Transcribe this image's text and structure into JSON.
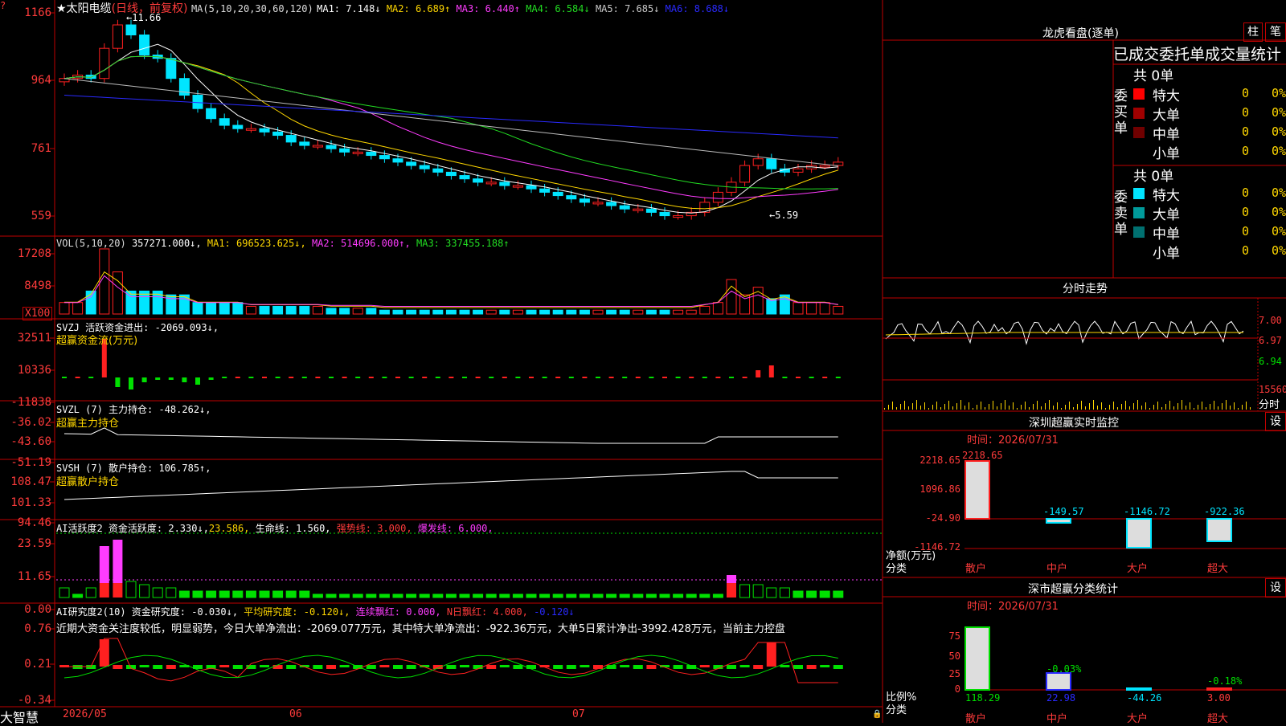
{
  "stock": {
    "title": "★太阳电缆",
    "period": "(日线，前复权)",
    "ma_label": "MA(5,10,20,30,60,120)",
    "ma": [
      {
        "label": "MA1: 7.148",
        "arrow": "↓",
        "color": "#ffffff"
      },
      {
        "label": "MA2: 6.689",
        "arrow": "↑",
        "color": "#ffd700"
      },
      {
        "label": "MA3: 6.440",
        "arrow": "↑",
        "color": "#ff3cff"
      },
      {
        "label": "MA4: 6.584",
        "arrow": "↓",
        "color": "#22dd22"
      },
      {
        "label": "MA5: 7.685",
        "arrow": "↓",
        "color": "#cccccc"
      },
      {
        "label": "MA6: 8.688",
        "arrow": "↓",
        "color": "#2a2aff"
      }
    ],
    "high_label": "11.66",
    "low_label": "5.59",
    "y_ticks": [
      "1166",
      "964",
      "761",
      "559"
    ]
  },
  "vol": {
    "label": "VOL(5,10,20)",
    "val": "357271.000↓,",
    "ma1": "MA1: 696523.625↓,",
    "ma2": "MA2: 514696.000↑,",
    "ma3": "MA3: 337455.188↑",
    "y_ticks": [
      "17208",
      "8498"
    ],
    "unit": "X100"
  },
  "svzj": {
    "label": "SVZJ  活跃资金进出: -2069.093↓,",
    "sub": "超赢资金流(万元)",
    "y_ticks": [
      "32511",
      "10336",
      "-11838"
    ]
  },
  "svzl": {
    "label": "SVZL (7) 主力持仓: -48.262↓,",
    "sub": "超赢主力持仓",
    "y_ticks": [
      "-36.02",
      "-43.60",
      "-51.19"
    ]
  },
  "svsh": {
    "label": "SVSH (7) 散户持仓: 106.785↑,",
    "sub": "超赢散户持仓",
    "y_ticks": [
      "108.47",
      "101.33",
      "94.46"
    ]
  },
  "ai1": {
    "label": "AI活跃度2 资金活跃度: 2.330↓,",
    "v2": "23.586,",
    "v3": "生命线: 1.560,",
    "v4": "强势线: 3.000,",
    "v5": "爆发线: 6.000,",
    "y_ticks": [
      "23.59",
      "11.65",
      "0.00"
    ]
  },
  "ai2": {
    "label": "AI研究度2(10) 资金研究度: -0.030↓,",
    "v2": "平均研究度: -0.120↓,",
    "v3": "连续飘红: 0.000,",
    "v4": "N日飘红: 4.000,",
    "v5": "-0.120↓",
    "text": "近期大资金关注度较低，明显弱势，今日大单净流出：-2069.077万元，其中特大单净流出：-922.36万元，大单5日累计净出-3992.428万元，当前主力控盘",
    "y_ticks": [
      "0.76",
      "0.21",
      "-0.34"
    ]
  },
  "xaxis": {
    "labels": [
      "2026/05",
      "06",
      "07"
    ],
    "brand": "大智慧"
  },
  "right": {
    "lh_title": "龙虎看盘(逐单)",
    "btn_zhu": "柱",
    "btn_bi": "笔",
    "tab_text": "已成交委托单成交量统计",
    "buy_side": "委买单",
    "sell_side": "委卖单",
    "buy_total": "共 0单",
    "sell_total": "共 0单",
    "rows_buy": [
      {
        "name": "特大",
        "n": "0",
        "p": "0%",
        "color": "#ff0000"
      },
      {
        "name": "大单",
        "n": "0",
        "p": "0%",
        "color": "#a00000"
      },
      {
        "name": "中单",
        "n": "0",
        "p": "0%",
        "color": "#700000"
      },
      {
        "name": "小单",
        "n": "0",
        "p": "0%",
        "color": ""
      }
    ],
    "rows_sell": [
      {
        "name": "特大",
        "n": "0",
        "p": "0%",
        "color": "#00e5ff"
      },
      {
        "name": "大单",
        "n": "0",
        "p": "0%",
        "color": "#009a9a"
      },
      {
        "name": "中单",
        "n": "0",
        "p": "0%",
        "color": "#007070"
      },
      {
        "name": "小单",
        "n": "0",
        "p": "0%",
        "color": ""
      }
    ],
    "fs_title": "分时走势",
    "fs_ticks": [
      "7.00",
      "6.97",
      "6.94"
    ],
    "fs_vol": "15560",
    "fs_vol_unit": "分时",
    "sz_title": "深圳超赢实时监控",
    "sz_btn": "设",
    "sz_time": "时间：2026/07/31",
    "sz_y": [
      "2218.65",
      "1096.86",
      "-24.90",
      "-1146.72"
    ],
    "sz_vals": [
      "2218.65",
      "-149.57",
      "-1146.72",
      "-922.36"
    ],
    "sz_unit": "净额(万元)",
    "sz_cat": "分类",
    "cats": [
      "散户",
      "中户",
      "大户",
      "超大"
    ],
    "sc_title": "深市超赢分类统计",
    "sc_btn": "设",
    "sc_time": "时间：2026/07/31",
    "sc_y": [
      "75",
      "50",
      "25",
      "0"
    ],
    "sc_pct": [
      "-0.03%",
      "-0.18%"
    ],
    "sc_vals": [
      "118.29",
      "22.98",
      "-44.26",
      "3.00"
    ],
    "sc_unit": "比例%",
    "sc_cat": "分类"
  }
}
